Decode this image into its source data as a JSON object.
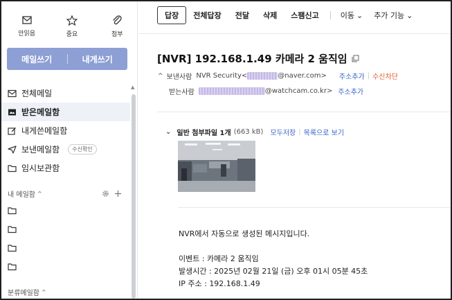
{
  "sidebar": {
    "quick": [
      {
        "icon": "envelope-icon",
        "label": "안읽음"
      },
      {
        "icon": "star-icon",
        "label": "중요"
      },
      {
        "icon": "paperclip-icon",
        "label": "첨부"
      }
    ],
    "compose_label": "메일쓰기",
    "self_label": "내게쓰기",
    "menu": [
      {
        "icon": "mailbox-icon",
        "label": "전체메일"
      },
      {
        "icon": "inbox-icon",
        "label": "받은메일함"
      },
      {
        "icon": "edit-icon",
        "label": "내게쓴메일함"
      },
      {
        "icon": "send-icon",
        "label": "보낸메일함",
        "badge": "수신확인"
      },
      {
        "icon": "folder-icon",
        "label": "임시보관함"
      }
    ],
    "my_mailbox_label": "내 메일함",
    "category_label": "분류메일함"
  },
  "toolbar": {
    "reply": "답장",
    "reply_all": "전체답장",
    "forward": "전달",
    "delete": "삭제",
    "spam": "스팸신고",
    "move": "이동",
    "more": "추가 기능"
  },
  "mail": {
    "subject": "[NVR] 192.168.1.49 카메라 2 움직임",
    "sender_label": "보낸사람",
    "sender_name": "NVR Security<",
    "sender_domain": "@naver.com>",
    "add_contact": "주소추가",
    "block": "수신차단",
    "recipient_label": "받는사람",
    "recipient_domain": "@watchcam.co.kr>",
    "attach_title": "일반 첨부파일 1개",
    "attach_size": "(663 kB)",
    "save_all": "모두저장",
    "list_view": "목록으로 보기",
    "body": {
      "line1": "NVR에서 자동으로 생성된 메시지입니다.",
      "line2": "이벤트 : 카메라 2 움직임",
      "line3": "발생시간 : 2025년 02월 21일 (금) 오후 01시 05분 45초",
      "line4": "IP 주소 : 192.168.1.49"
    }
  },
  "colors": {
    "accent": "#8d9fd4",
    "link": "#3a63c8",
    "warn": "#e25b28"
  }
}
